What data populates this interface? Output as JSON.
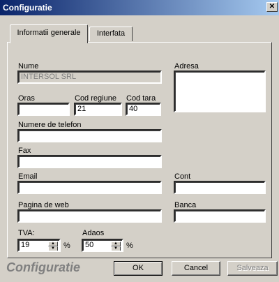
{
  "window": {
    "title": "Configuratie",
    "close_glyph": "✕"
  },
  "tabs": [
    {
      "label": "Informatii generale",
      "active": true
    },
    {
      "label": "Interfata",
      "active": false
    }
  ],
  "form": {
    "nume": {
      "label": "Nume",
      "value": "INTERSOL SRL",
      "disabled": true
    },
    "oras": {
      "label": "Oras",
      "value": ""
    },
    "cod_regiune": {
      "label": "Cod regiune",
      "value": "21"
    },
    "cod_tara": {
      "label": "Cod tara",
      "value": "40"
    },
    "telefon": {
      "label": "Numere de telefon",
      "value": ""
    },
    "fax": {
      "label": "Fax",
      "value": ""
    },
    "email": {
      "label": "Email",
      "value": ""
    },
    "web": {
      "label": "Pagina de web",
      "value": ""
    },
    "adresa": {
      "label": "Adresa",
      "value": ""
    },
    "cont": {
      "label": "Cont",
      "value": ""
    },
    "banca": {
      "label": "Banca",
      "value": ""
    },
    "tva": {
      "label": "TVA:",
      "value": "19",
      "unit": "%"
    },
    "adaos": {
      "label": "Adaos",
      "value": "50",
      "unit": "%"
    }
  },
  "footer": {
    "title": "Configuratie",
    "ok_label": "OK",
    "cancel_label": "Cancel",
    "save_label": "Salveaza"
  }
}
